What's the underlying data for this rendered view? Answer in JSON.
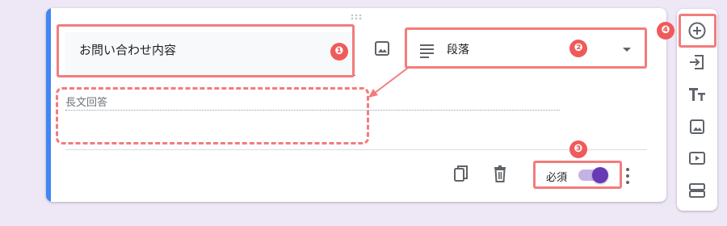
{
  "question": {
    "title": "お問い合わせ内容",
    "type_label": "段落",
    "answer_placeholder": "長文回答",
    "required_label": "必須",
    "required_on": true
  },
  "annotations": [
    "❶",
    "❷",
    "❸",
    "❹"
  ],
  "colors": {
    "accent": "#4285f4",
    "toggle": "#673ab7",
    "highlight": "#f27c7c",
    "background": "#ede7f6"
  },
  "toolbar_icons": [
    "add-question-icon",
    "import-questions-icon",
    "title-text-icon",
    "add-image-icon",
    "add-video-icon",
    "add-section-icon"
  ]
}
